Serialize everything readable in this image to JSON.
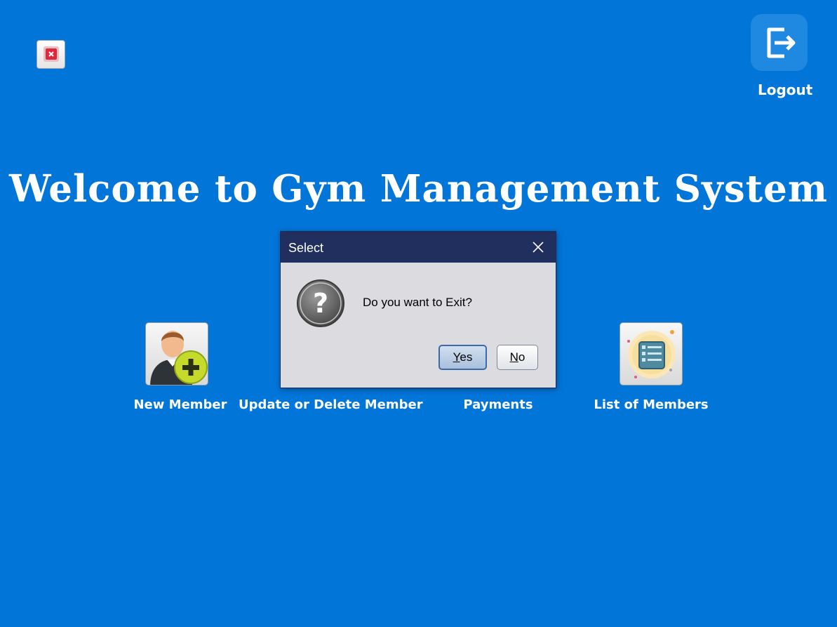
{
  "window": {
    "close_icon": "close-icon",
    "logout": {
      "label": "Logout",
      "icon": "logout-icon"
    }
  },
  "main": {
    "title": "Welcome to Gym Management System",
    "tiles": [
      {
        "label": "New Member",
        "icon": "add-member-icon"
      },
      {
        "label": "Update or Delete Member",
        "icon": null
      },
      {
        "label": "Payments",
        "icon": null
      },
      {
        "label": "List of Members",
        "icon": "member-list-icon"
      }
    ]
  },
  "dialog": {
    "title": "Select",
    "message": "Do you want to Exit?",
    "icon": "question-icon",
    "buttons": {
      "yes": "Yes",
      "no": "No"
    }
  },
  "colors": {
    "background": "#0275d9",
    "dialog_titlebar": "#212f5e",
    "dialog_body": "#dcdce0"
  }
}
